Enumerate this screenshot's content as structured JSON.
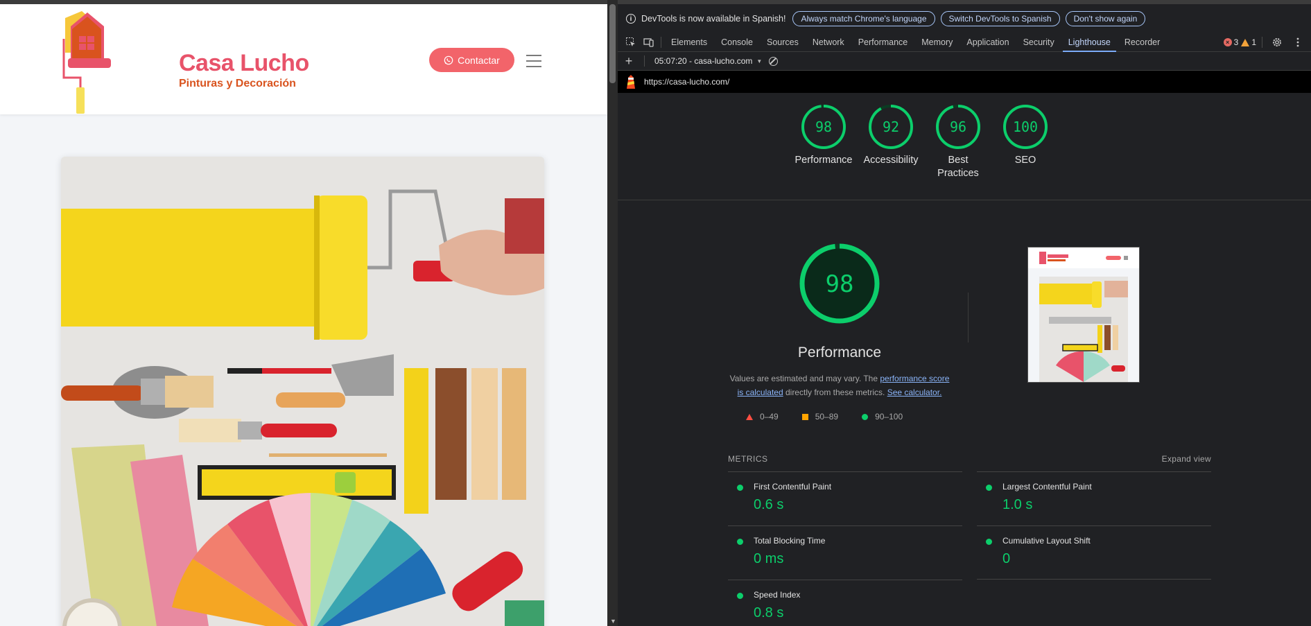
{
  "site": {
    "logo_title": "Casa Lucho",
    "logo_subtitle": "Pinturas y Decoración",
    "contact_label": "Contactar",
    "brand_color": "#e8536a",
    "accent_color": "#d9531e",
    "button_color": "#f2646a"
  },
  "devtools": {
    "info_text": "DevTools is now available in Spanish!",
    "info_buttons": [
      "Always match Chrome's language",
      "Switch DevTools to Spanish",
      "Don't show again"
    ],
    "tabs": [
      "Elements",
      "Console",
      "Sources",
      "Network",
      "Performance",
      "Memory",
      "Application",
      "Security",
      "Lighthouse",
      "Recorder"
    ],
    "active_tab": "Lighthouse",
    "error_count": "3",
    "warning_count": "1",
    "report_select": "05:07:20 - casa-lucho.com",
    "url": "https://casa-lucho.com/"
  },
  "lighthouse": {
    "scores": [
      {
        "label": "Performance",
        "score": 98
      },
      {
        "label": "Accessibility",
        "score": 92
      },
      {
        "label": "Best Practices",
        "score": 96
      },
      {
        "label": "SEO",
        "score": 100
      }
    ],
    "main_score": 98,
    "main_title": "Performance",
    "desc_prefix": "Values are estimated and may vary. The ",
    "desc_link1": "performance score is calculated",
    "desc_middle": " directly from these metrics. ",
    "desc_link2": "See calculator.",
    "legend": [
      "0–49",
      "50–89",
      "90–100"
    ],
    "metrics_title": "METRICS",
    "expand_label": "Expand view",
    "metrics": [
      {
        "name": "First Contentful Paint",
        "value": "0.6 s"
      },
      {
        "name": "Largest Contentful Paint",
        "value": "1.0 s"
      },
      {
        "name": "Total Blocking Time",
        "value": "0 ms"
      },
      {
        "name": "Cumulative Layout Shift",
        "value": "0"
      },
      {
        "name": "Speed Index",
        "value": "0.8 s"
      }
    ],
    "pass_color": "#0cce6b"
  }
}
